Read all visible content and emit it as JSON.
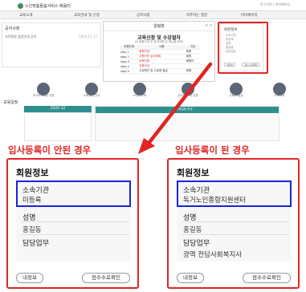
{
  "site": {
    "logo_text": "노인맞춤돌봄서비스 배움터",
    "util_text": "로그아웃 | 마이페이지",
    "nav": [
      "교육소개",
      "교육안내 및 신청",
      "공지사항",
      "자주하는 질문",
      "마이페이지"
    ],
    "notice": {
      "title": "공지사항",
      "row": "교육환경 점검안내 공지",
      "date": "2020.12.17"
    },
    "popup": {
      "header": "알림창",
      "nav": "< >",
      "title": "교육신청 및 수강절차",
      "subtitle": "(※ 회원가입 후 공지사항 및 매뉴얼 참조)",
      "table_header": [
        "진행단계",
        "내용",
        "구분"
      ],
      "rows": [
        [
          "step 1",
          "회원가입",
          "회원"
        ],
        [
          "step 2",
          "수행기관 입사등록",
          "회원"
        ],
        [
          "step 3",
          "교육신청",
          "배움터"
        ],
        [
          "step 4",
          "교육수강",
          ""
        ],
        [
          "step 5",
          "수료확인 및 수료증 발급",
          "회원"
        ]
      ]
    },
    "member_small": {
      "title": "회원정보",
      "items": [
        "소속기관",
        "미등록",
        "성명",
        "홍길동",
        "담당업무"
      ],
      "btn_left": "내정보",
      "btn_right": "점수수료확인"
    },
    "icons": [
      "국가교육과정 신청",
      "교육일정 안내",
      "e러닝 교육",
      "온라인 교육 신청",
      "수료증 발급",
      "교육자료"
    ],
    "calendar": {
      "title": "교육일정",
      "month": "2020.12",
      "right_header": "교육일정 안내"
    }
  },
  "left": {
    "caption": "입사등록이 안된 경우",
    "title": "회원정보",
    "org_label": "소속기관",
    "org_value": "미등록",
    "name_label": "성명",
    "name_value": "홍길동",
    "duty_label": "담당업무",
    "duty_value": "",
    "btn_info": "내정보",
    "btn_cert": "점수수료확인"
  },
  "right": {
    "caption": "입사등록이 된 경우",
    "title": "회원정보",
    "org_label": "소속기관",
    "org_value": "독거노인종합지원센터",
    "name_label": "성명",
    "name_value": "홍길동",
    "duty_label": "담당업무",
    "duty_value": "광역 전담사회복지사",
    "btn_info": "내정보",
    "btn_cert": "점수수료확인"
  },
  "colors": {
    "highlight_red": "#e02424",
    "highlight_blue": "#1a24d8",
    "calendar_teal": "#2f8f8f"
  }
}
